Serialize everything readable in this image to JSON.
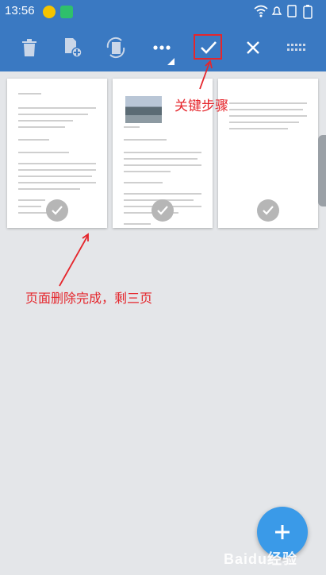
{
  "status_bar": {
    "time": "13:56",
    "battery_icon": "battery-icon"
  },
  "toolbar": {
    "delete_icon": "trash-icon",
    "add_page_icon": "add-page-icon",
    "rotate_icon": "rotate-icon",
    "more_icon": "more-dots-icon",
    "confirm_icon": "check-icon",
    "close_icon": "close-icon",
    "grid_icon": "grid-icon"
  },
  "annotations": {
    "key_step": "关键步骤",
    "result": "页面删除完成，剩三页"
  },
  "watermark": "Baidu经验",
  "colors": {
    "toolbar": "#3a79c2",
    "annotation": "#e5262c",
    "fab": "#3a9ae8"
  }
}
